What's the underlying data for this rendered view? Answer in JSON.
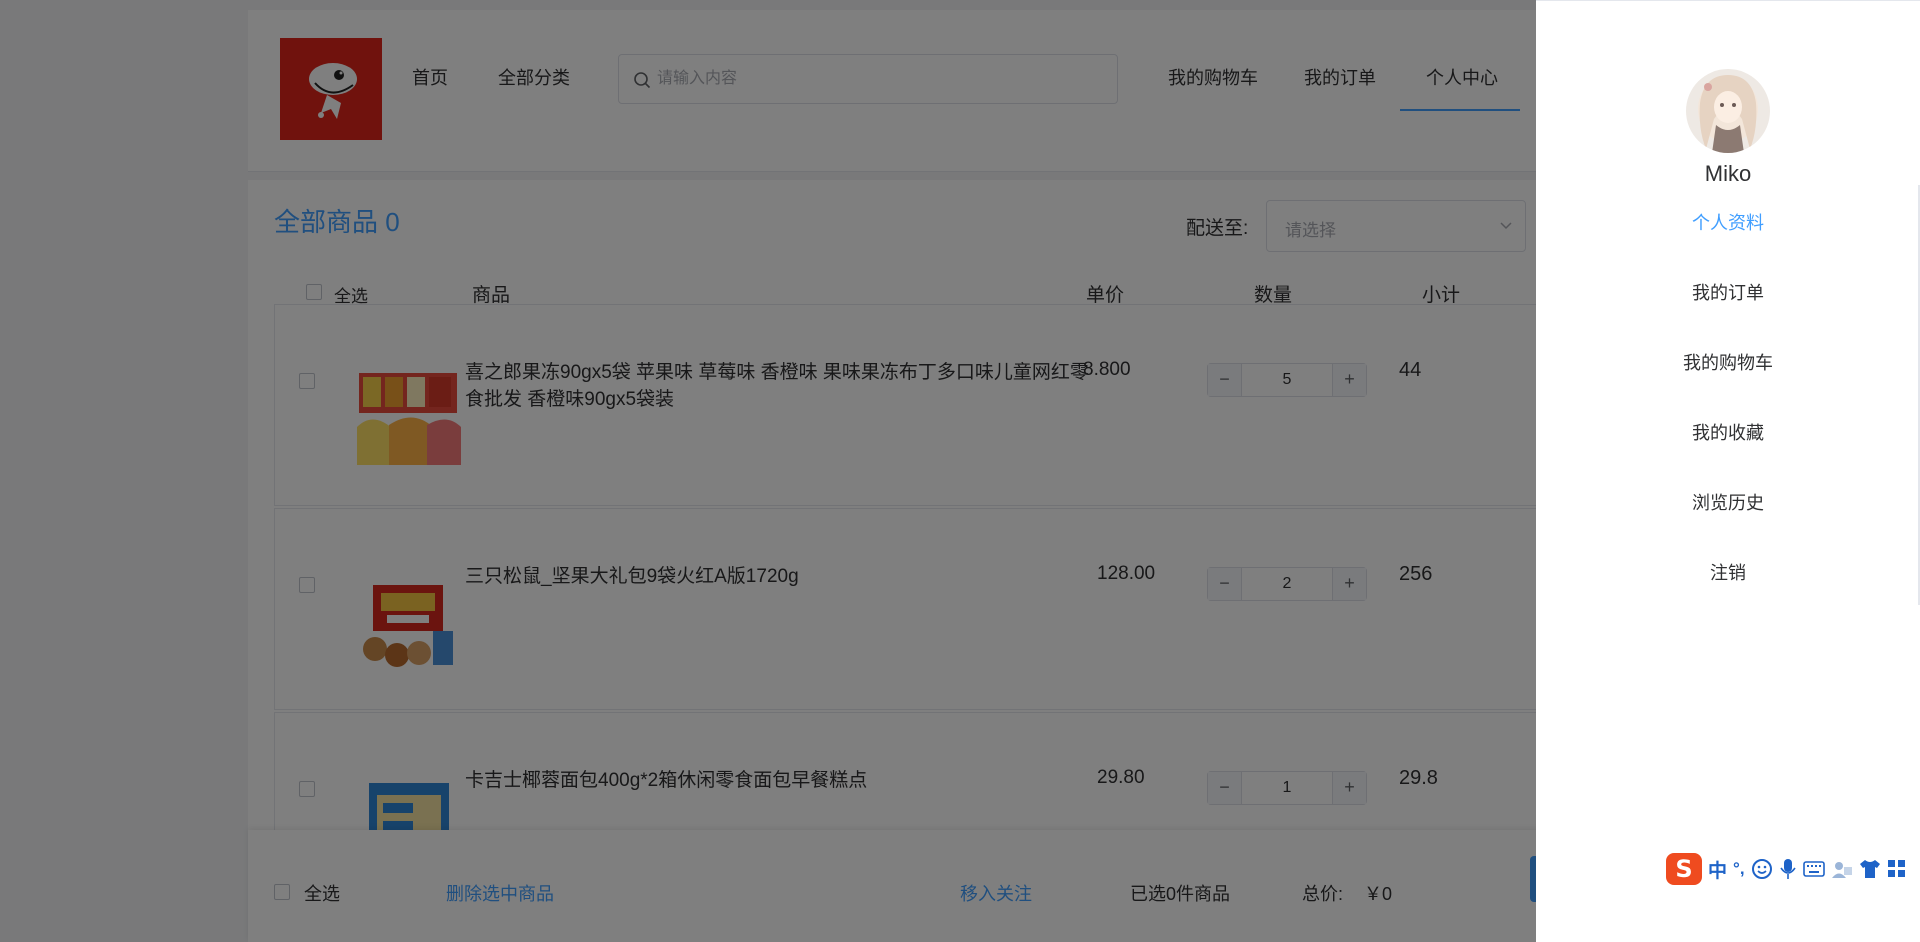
{
  "header": {
    "nav": [
      "首页",
      "全部分类"
    ],
    "search_placeholder": "请输入内容",
    "right_nav": [
      "我的购物车",
      "我的订单",
      "个人中心"
    ]
  },
  "cart": {
    "title": "全部商品 0",
    "ship_label": "配送至:",
    "ship_placeholder": "请选择",
    "columns": {
      "select_all": "全选",
      "goods": "商品",
      "unit_price": "单价",
      "quantity": "数量",
      "subtotal": "小计"
    },
    "items": [
      {
        "name": "喜之郎果冻90gx5袋 苹果味 草莓味 香橙味 果味果冻布丁多口味儿童网红零食批发 香橙味90gx5袋装",
        "price": "8.800",
        "qty": "5",
        "subtotal": "44"
      },
      {
        "name": "三只松鼠_坚果大礼包9袋火红A版1720g",
        "price": "128.00",
        "qty": "2",
        "subtotal": "256"
      },
      {
        "name": "卡吉士椰蓉面包400g*2箱休闲零食面包早餐糕点",
        "price": "29.80",
        "qty": "1",
        "subtotal": "29.8"
      }
    ]
  },
  "footer": {
    "select_all": "全选",
    "delete_selected": "删除选中商品",
    "move_to_favorites": "移入关注",
    "selected_count": "已选0件商品",
    "total_label": "总价:",
    "total_value": "￥0"
  },
  "drawer": {
    "username": "Miko",
    "menu": [
      "个人资料",
      "我的订单",
      "我的购物车",
      "我的收藏",
      "浏览历史",
      "注销"
    ],
    "active_index": 0
  },
  "ime": {
    "mode": "中",
    "punct": "°,"
  },
  "colors": {
    "accent": "#409eff",
    "brand_red": "#e1251b",
    "ime_orange": "#ef4b1f"
  }
}
